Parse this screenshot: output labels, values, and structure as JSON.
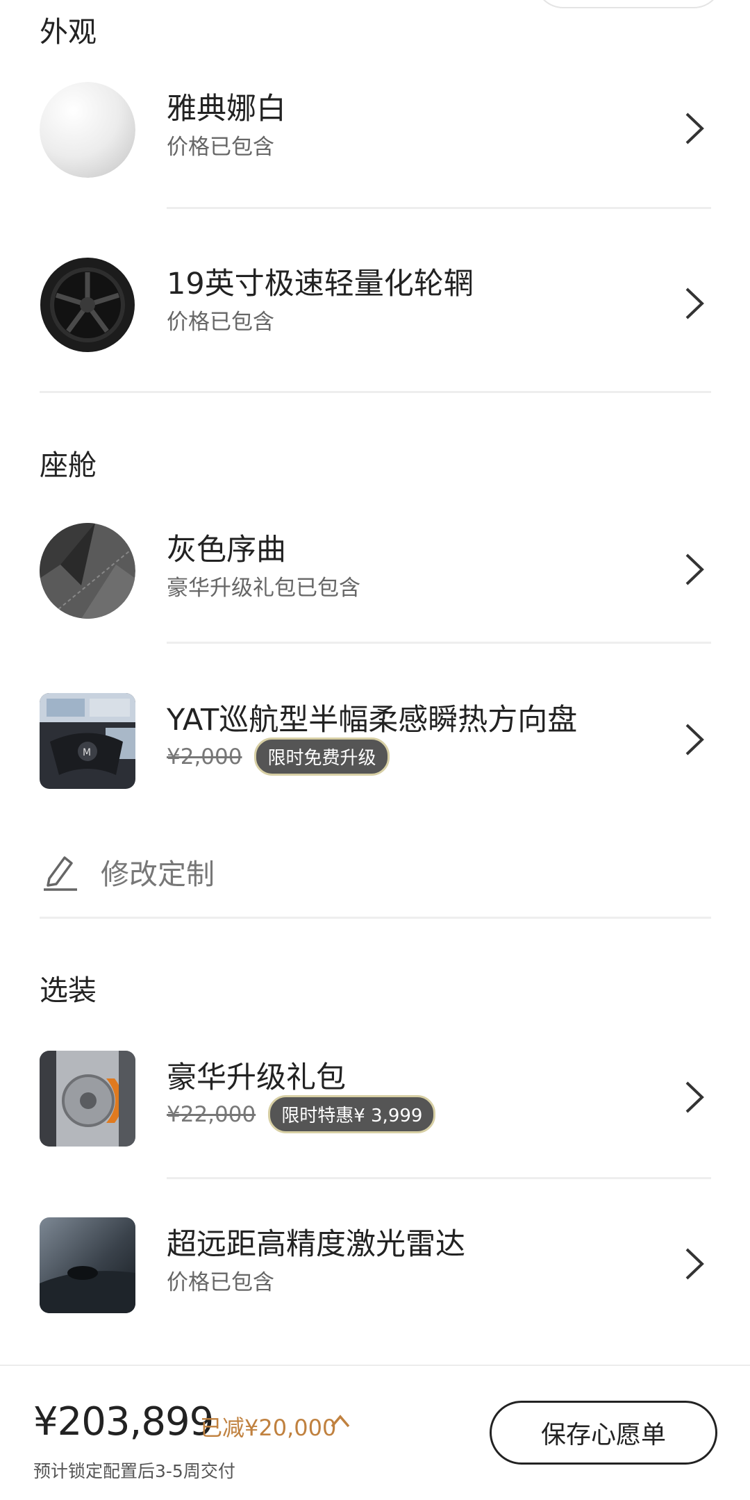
{
  "sections": {
    "exterior": "外观",
    "cabin": "座舱",
    "options": "选装"
  },
  "items": [
    {
      "title": "雅典娜白",
      "subtitle": "价格已包含",
      "icon": "white-paint-swatch"
    },
    {
      "title": "19英寸极速轻量化轮辋",
      "subtitle": "价格已包含",
      "icon": "wheel-icon"
    },
    {
      "title": "灰色序曲",
      "subtitle": "豪华升级礼包已包含",
      "icon": "gray-interior-swatch"
    },
    {
      "title": "YAT巡航型半幅柔感瞬热方向盘",
      "original_price": "¥2,000",
      "tag": "限时免费升级",
      "icon": "steering-wheel-photo"
    },
    {
      "title": "豪华升级礼包",
      "original_price": "¥22,000",
      "tag": "限时特惠¥ 3,999",
      "icon": "brake-caliper-photo"
    },
    {
      "title": "超远距高精度激光雷达",
      "subtitle": "价格已包含",
      "icon": "lidar-photo"
    }
  ],
  "edit": {
    "label": "修改定制",
    "icon": "pencil-icon"
  },
  "footer": {
    "total_price": "¥203,899",
    "discount": "已减¥20,000",
    "delivery": "预计锁定配置后3-5周交付",
    "save_button": "保存心愿单"
  },
  "colors": {
    "accent_discount": "#c0813f",
    "tag_background": "#555555",
    "tag_border": "#d7cfa4"
  }
}
